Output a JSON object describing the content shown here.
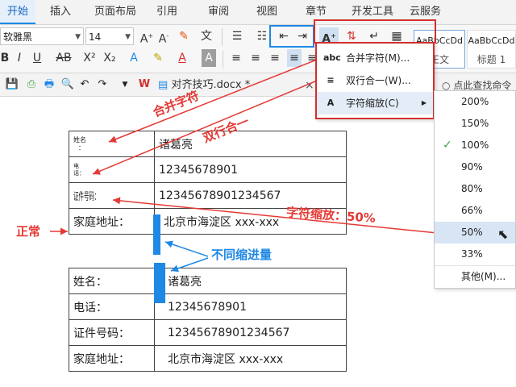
{
  "ribbon_tabs": [
    "开始",
    "插入",
    "页面布局",
    "引用",
    "审阅",
    "视图",
    "章节",
    "开发工具",
    "云服务"
  ],
  "ribbon": {
    "font_name": "软雅黑",
    "font_size": "14",
    "style_preview_1": "AaBbCcDd",
    "style_label_1": "正文",
    "style_preview_2": "AaBbCcDd",
    "style_label_2": "标题 1"
  },
  "document_tab": {
    "title": "对齐技巧.docx *"
  },
  "find_hint": "点此查找命令",
  "dropdown": {
    "items": [
      {
        "icon": "abc",
        "label": "合并字符(M)..."
      },
      {
        "icon": "≡",
        "label": "双行合一(W)..."
      },
      {
        "icon": "A",
        "label": "字符缩放(C)"
      }
    ]
  },
  "scale_menu": {
    "options": [
      "200%",
      "150%",
      "100%",
      "90%",
      "80%",
      "66%",
      "50%",
      "33%",
      "其他(M)..."
    ],
    "checked": "100%",
    "highlighted": "50%"
  },
  "table1": {
    "rows": [
      {
        "label": "姓名",
        "label_sub": "：",
        "value": "诸葛亮"
      },
      {
        "label": "电",
        "label_sub": "话：",
        "value": "12345678901"
      },
      {
        "label": "证件号码：",
        "value": "12345678901234567"
      },
      {
        "label": "家庭地址：",
        "value": "北京市海淀区 xxx-xxx"
      }
    ]
  },
  "table2": {
    "rows": [
      {
        "label": "姓名：",
        "value": "诸葛亮"
      },
      {
        "label": "电话：",
        "value": "12345678901"
      },
      {
        "label": "证件号码：",
        "value": "12345678901234567"
      },
      {
        "label": "家庭地址：",
        "value": "北京市海淀区 xxx-xxx"
      }
    ]
  },
  "annotations": {
    "merge_chars": "合并字符",
    "two_lines": "双行合一",
    "char_scale": "字符缩放：50%",
    "normal": "正常",
    "indent": "不同缩进量"
  },
  "colors": {
    "annotation_red": "#e53935",
    "annotation_blue": "#1e88e5",
    "active_tab": "#1565c0"
  }
}
